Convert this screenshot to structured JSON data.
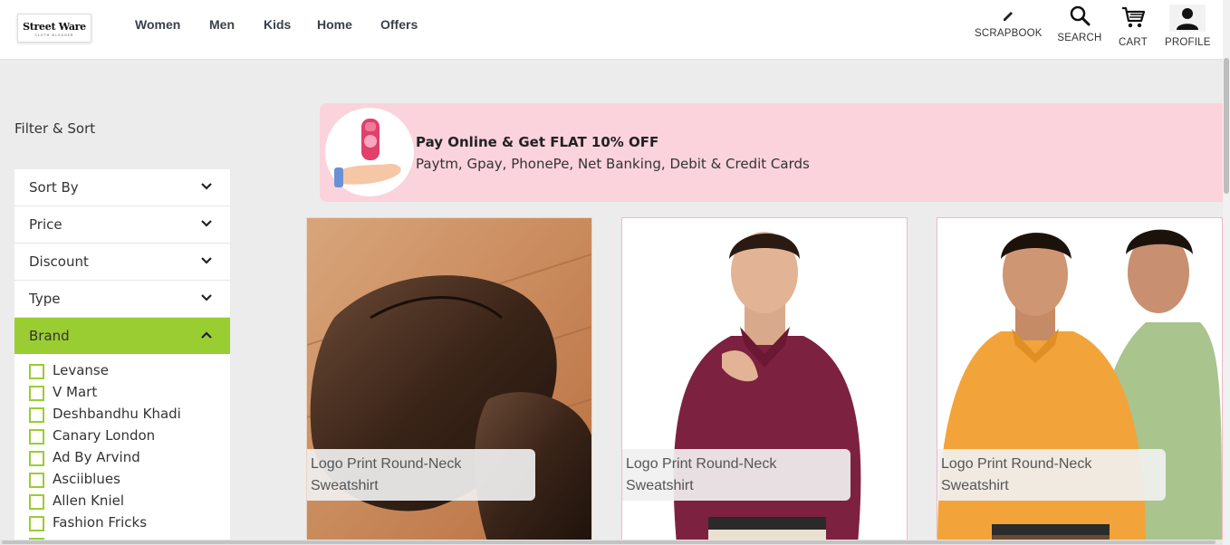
{
  "header": {
    "logo_main": "Street Ware",
    "logo_sub": "CLOTH BLOGGER",
    "nav": [
      "Women",
      "Men",
      "Kids",
      "Home",
      "Offers"
    ],
    "actions": [
      {
        "label": "SCRAPBOOK",
        "icon": "pencil-icon"
      },
      {
        "label": "SEARCH",
        "icon": "search-icon"
      },
      {
        "label": "CART",
        "icon": "cart-icon"
      },
      {
        "label": "PROFILE",
        "icon": "user-icon"
      }
    ]
  },
  "sidebar": {
    "title": "Filter & Sort",
    "sections": [
      {
        "label": "Sort By",
        "expanded": false
      },
      {
        "label": "Price",
        "expanded": false
      },
      {
        "label": "Discount",
        "expanded": false
      },
      {
        "label": "Type",
        "expanded": false
      },
      {
        "label": "Brand",
        "expanded": true
      }
    ],
    "brands": [
      "Levanse",
      "V Mart",
      "Deshbandhu Khadi",
      "Canary London",
      "Ad By Arvind",
      "Asciiblues",
      "Allen Kniel",
      "Fashion Fricks"
    ],
    "accent": "#9acd32"
  },
  "banner": {
    "title": "Pay Online & Get FLAT 10% OFF",
    "subtitle": "Paytm, Gpay, PhonePe, Net Banking, Debit & Credit Cards",
    "background": "#fad3dc"
  },
  "products": [
    {
      "name": "Logo Print Round-Neck Sweatshirt",
      "image": "brown-leather-loafers"
    },
    {
      "name": "Logo Print Round-Neck Sweatshirt",
      "image": "man-maroon-printed-shirt"
    },
    {
      "name": "Logo Print Round-Neck Sweatshirt",
      "image": "men-yellow-green-shirts"
    }
  ]
}
